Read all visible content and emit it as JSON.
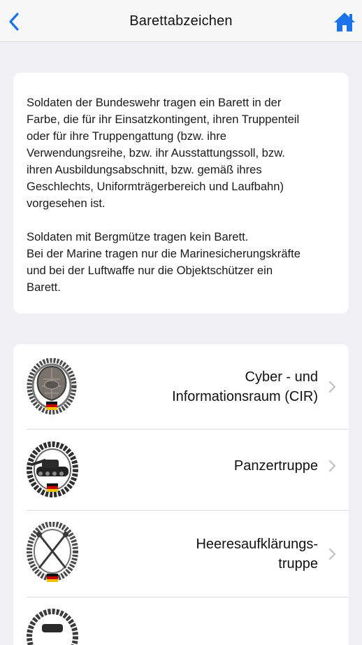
{
  "navbar": {
    "title": "Barettabzeichen",
    "back_icon": "chevron-left-icon",
    "home_icon": "home-icon",
    "accent_color": "#1a73e8"
  },
  "info": {
    "paragraph1": "Soldaten der Bundeswehr tragen ein Barett in der\nFarbe, die für ihr Einsatzkontingent, ihren Truppenteil\noder für ihre Truppengattung (bzw. ihre\nVerwendungsreihe, bzw. ihr Ausstattungssoll, bzw.\nihren Ausbildungsabschnitt, bzw. gemäß ihres\nGeschlechts, Uniformträgerbereich und Laufbahn)\nvorgesehen ist.",
    "paragraph2": "Soldaten mit Bergmütze tragen kein Barett.\nBei der Marine tragen nur die Marinesicherungskräfte\nund bei der Luftwaffe nur die Objektschützer ein\nBarett."
  },
  "list": {
    "items": [
      {
        "label": "Cyber - und\nInformationsraum (CIR)",
        "badge_icon": "cir-beret-badge-icon"
      },
      {
        "label": "Panzertruppe",
        "badge_icon": "tank-beret-badge-icon"
      },
      {
        "label": "Heeresaufklärungs-\ntruppe",
        "badge_icon": "reconnaissance-beret-badge-icon"
      },
      {
        "label": "",
        "badge_icon": "beret-badge-icon"
      }
    ]
  }
}
